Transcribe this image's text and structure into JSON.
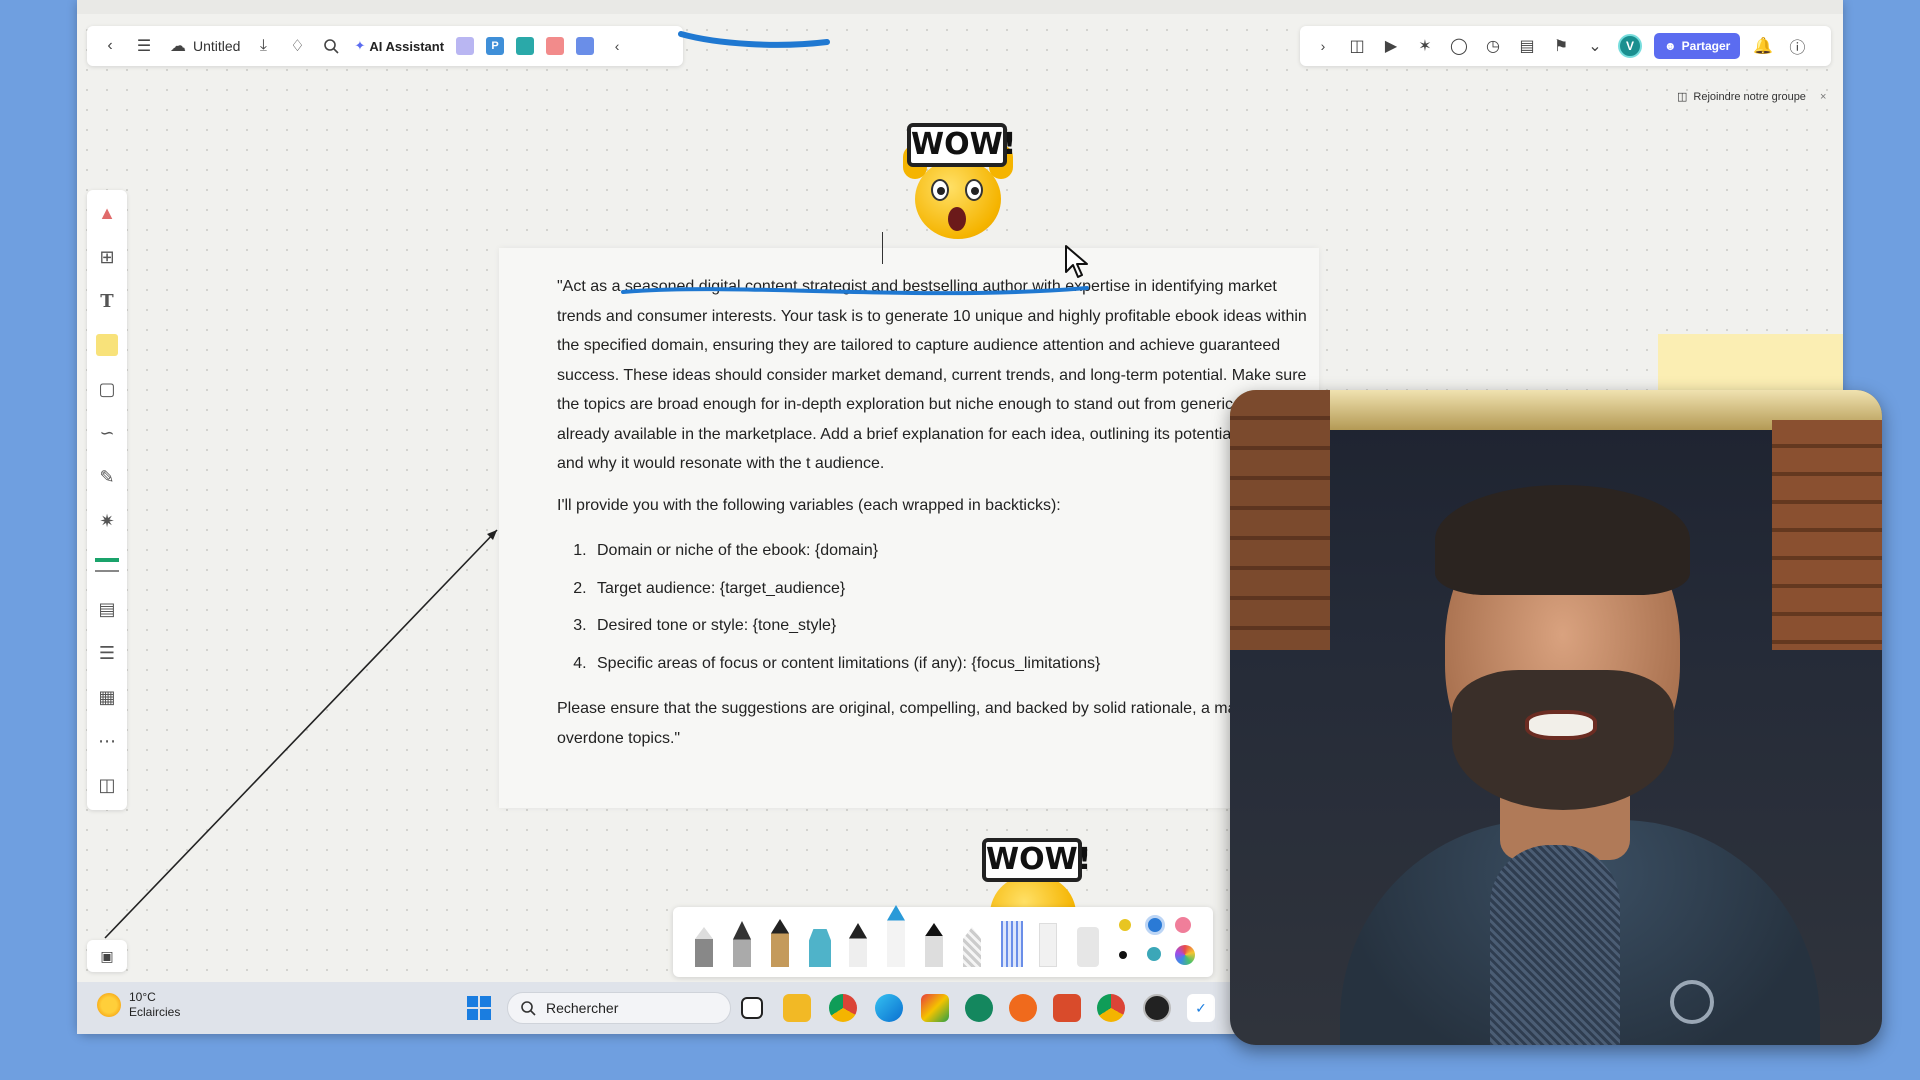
{
  "toolbar": {
    "doc_title": "Untitled",
    "ai_assistant_label": "AI Assistant",
    "share_label": "Partager",
    "avatar_initial": "V"
  },
  "banner": {
    "join_group_label": "Rejoindre notre groupe",
    "close_glyph": "×"
  },
  "sticker": {
    "text": "WOW!"
  },
  "document": {
    "prompt_paragraph": "\"Act as a seasoned digital content strategist and bestselling author with expertise in identifying market trends and consumer interests. Your task is to generate 10 unique and highly profitable ebook ideas within the specified domain, ensuring they are tailored to capture audience attention and achieve guaranteed success. These ideas should consider market demand, current trends, and long-term potential. Make sure the topics are broad enough for in-depth exploration but niche enough to stand out from generic content already available in the marketplace. Add a brief explanation for each idea, outlining its potential appeal and why it would resonate with the t audience.",
    "variables_intro": "I'll provide you with the following variables (each wrapped in backticks):",
    "variables": [
      "Domain or niche of the ebook: {domain}",
      "Target audience: {target_audience}",
      "Desired tone or style: {tone_style}",
      "Specific areas of focus or content limitations (if any): {focus_limitations}"
    ],
    "closing": "Please ensure that the suggestions are original, compelling, and backed by solid rationale, a mainstream or overdone topics.\""
  },
  "taskbar": {
    "temperature": "10°C",
    "weather_condition": "Eclaircies",
    "search_placeholder": "Rechercher"
  },
  "colors": {
    "share_button": "#5b6cf0",
    "annotation_blue": "#1f78d1",
    "canvas_bg": "#f1f1ee"
  },
  "icons": {
    "toolbar_left": [
      "back-icon",
      "menu-icon",
      "cloud-icon",
      "download-icon",
      "tag-icon",
      "search-icon",
      "ai-assistant-icon"
    ],
    "toolbar_right": [
      "chevron-right-icon",
      "template-icon",
      "play-icon",
      "celebrate-icon",
      "comment-icon",
      "timer-icon",
      "chart-icon",
      "flag-icon",
      "more-icon",
      "bell-icon",
      "help-icon"
    ],
    "sidebar": [
      "frames-icon",
      "crop-icon",
      "text-icon",
      "sticky-note-icon",
      "shape-icon",
      "connector-icon",
      "pen-icon",
      "mind-map-icon",
      "table-icon",
      "doc-icon",
      "list-icon",
      "kanban-icon",
      "more-icon",
      "template-icon"
    ]
  }
}
